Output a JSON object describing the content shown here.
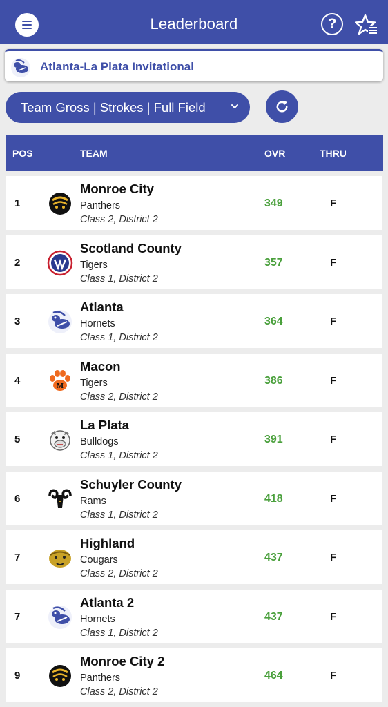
{
  "header": {
    "title": "Leaderboard"
  },
  "event": {
    "name": "Atlanta-La Plata Invitational"
  },
  "filter": {
    "label": "Team Gross | Strokes | Full Field"
  },
  "columns": {
    "pos": "POS",
    "team": "TEAM",
    "ovr": "OVR",
    "thru": "THRU"
  },
  "colors": {
    "primary": "#3f4fa8",
    "score": "#4aa03c",
    "background": "#ececec"
  },
  "rows": [
    {
      "pos": "1",
      "team": "Monroe City",
      "mascot": "Panthers",
      "class": "Class 2, District 2",
      "ovr": "349",
      "thru": "F",
      "logo": "panther-icon"
    },
    {
      "pos": "2",
      "team": "Scotland County",
      "mascot": "Tigers",
      "class": "Class 1, District 2",
      "ovr": "357",
      "thru": "F",
      "logo": "tiger-shield-icon"
    },
    {
      "pos": "3",
      "team": "Atlanta",
      "mascot": "Hornets",
      "class": "Class 1, District 2",
      "ovr": "364",
      "thru": "F",
      "logo": "hornet-icon"
    },
    {
      "pos": "4",
      "team": "Macon",
      "mascot": "Tigers",
      "class": "Class 2, District 2",
      "ovr": "386",
      "thru": "F",
      "logo": "paw-print-icon"
    },
    {
      "pos": "5",
      "team": "La Plata",
      "mascot": "Bulldogs",
      "class": "Class 1, District 2",
      "ovr": "391",
      "thru": "F",
      "logo": "bulldog-icon"
    },
    {
      "pos": "6",
      "team": "Schuyler County",
      "mascot": "Rams",
      "class": "Class 1, District 2",
      "ovr": "418",
      "thru": "F",
      "logo": "ram-icon"
    },
    {
      "pos": "7",
      "team": "Highland",
      "mascot": "Cougars",
      "class": "Class 2, District 2",
      "ovr": "437",
      "thru": "F",
      "logo": "cougar-icon"
    },
    {
      "pos": "7",
      "team": "Atlanta 2",
      "mascot": "Hornets",
      "class": "Class 1, District 2",
      "ovr": "437",
      "thru": "F",
      "logo": "hornet-icon"
    },
    {
      "pos": "9",
      "team": "Monroe City 2",
      "mascot": "Panthers",
      "class": "Class 2, District 2",
      "ovr": "464",
      "thru": "F",
      "logo": "panther-icon"
    }
  ]
}
